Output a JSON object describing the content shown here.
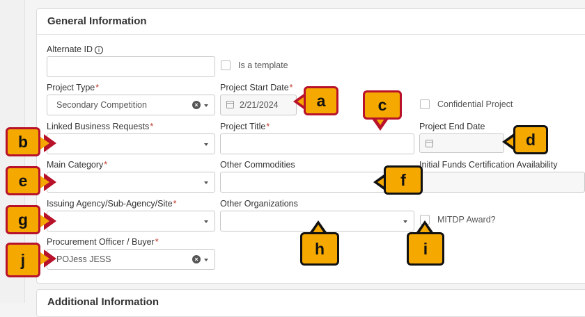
{
  "panel_title": "General Information",
  "next_panel_title": "Additional Information",
  "fields": {
    "alternate_id": {
      "label": "Alternate ID",
      "info": "i",
      "value": ""
    },
    "is_template": {
      "label": "Is a template"
    },
    "project_type": {
      "label": "Project Type",
      "required": "*",
      "value": "Secondary Competition"
    },
    "project_start_date": {
      "label": "Project Start Date",
      "required": "*",
      "value": "2/21/2024"
    },
    "confidential_project": {
      "label": "Confidential Project"
    },
    "linked_business_requests": {
      "label": "Linked Business Requests",
      "required": "*",
      "value": ""
    },
    "project_title": {
      "label": "Project Title",
      "required": "*",
      "value": ""
    },
    "project_end_date": {
      "label": "Project End Date",
      "value": ""
    },
    "main_category": {
      "label": "Main Category",
      "required": "*",
      "value": ""
    },
    "other_commodities": {
      "label": "Other Commodities",
      "value": ""
    },
    "initial_funds": {
      "label": "Initial Funds Certification Availability",
      "value": ""
    },
    "issuing_agency": {
      "label": "Issuing Agency/Sub-Agency/Site",
      "required": "*",
      "value": ""
    },
    "other_organizations": {
      "label": "Other Organizations",
      "value": ""
    },
    "mitdp_award": {
      "label": "MITDP Award?"
    },
    "procurement_officer": {
      "label": "Procurement Officer / Buyer",
      "required": "*",
      "value": "POJess JESS"
    }
  },
  "callouts": [
    "a",
    "b",
    "c",
    "d",
    "e",
    "f",
    "g",
    "h",
    "i",
    "j"
  ],
  "colors": {
    "callout_fill": "#f5a800",
    "callout_border_red": "#b8122b",
    "callout_border_dark": "#111111",
    "required": "#c0392b"
  }
}
